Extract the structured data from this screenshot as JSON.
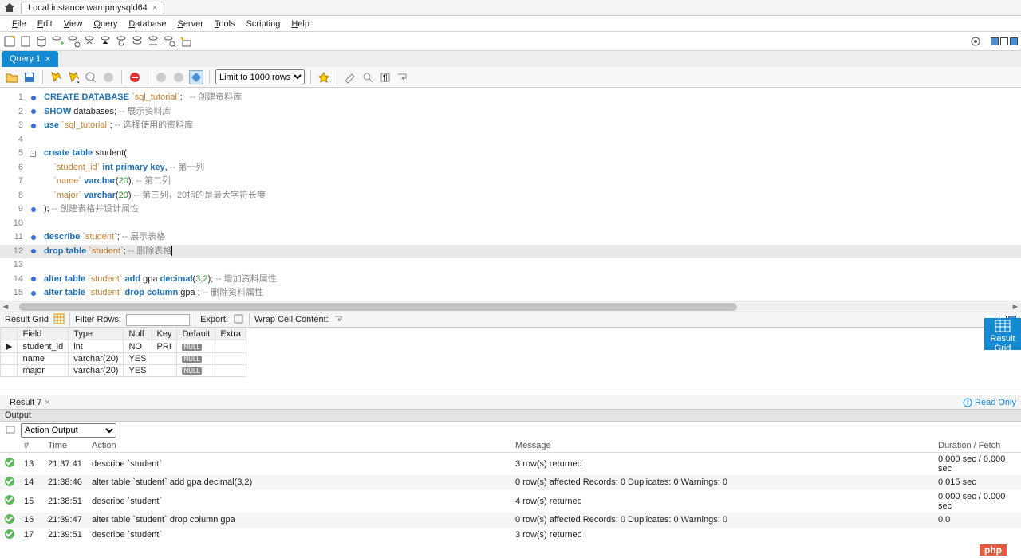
{
  "titlebar": {
    "tab_label": "Local instance wampmysqld64"
  },
  "menubar": [
    {
      "mn": "F",
      "rest": "ile"
    },
    {
      "mn": "E",
      "rest": "dit"
    },
    {
      "mn": "V",
      "rest": "iew"
    },
    {
      "mn": "Q",
      "rest": "uery"
    },
    {
      "mn": "D",
      "rest": "atabase"
    },
    {
      "mn": "S",
      "rest": "erver"
    },
    {
      "mn": "T",
      "rest": "ools"
    },
    {
      "mn": "",
      "rest": "Scripting"
    },
    {
      "mn": "H",
      "rest": "elp"
    }
  ],
  "query_tab": "Query 1",
  "limit_rows": "Limit to 1000 rows",
  "code": [
    {
      "n": 1,
      "dot": true,
      "html": "<span class='kw'>CREATE</span> <span class='kw'>DATABASE</span> <span class='str'>`sql_tutorial`</span>;   <span class='cm'>-- 创建资料库</span>"
    },
    {
      "n": 2,
      "dot": true,
      "html": "<span class='kw'>SHOW</span> databases; <span class='cm'>-- 展示资料库</span>"
    },
    {
      "n": 3,
      "dot": true,
      "html": "<span class='kw'>use</span> <span class='str'>`sql_tutorial`</span>; <span class='cm'>-- 选择使用的资料库</span>"
    },
    {
      "n": 4,
      "dot": false,
      "html": ""
    },
    {
      "n": 5,
      "dot": true,
      "fold": true,
      "html": "<span class='kw'>create</span> <span class='kw'>table</span> student("
    },
    {
      "n": 6,
      "dot": false,
      "html": "    <span class='str'>`student_id`</span> <span class='kw'>int</span> <span class='kw'>primary key</span>, <span class='cm'>-- 第一列</span>"
    },
    {
      "n": 7,
      "dot": false,
      "html": "    <span class='str'>`name`</span> <span class='kw'>varchar</span>(<span class='num'>20</span>), <span class='cm'>-- 第二列</span>"
    },
    {
      "n": 8,
      "dot": false,
      "html": "    <span class='str'>`major`</span> <span class='kw'>varchar</span>(<span class='num'>20</span>) <span class='cm'>-- 第三列，20指的是最大字符长度</span>"
    },
    {
      "n": 9,
      "dot": true,
      "html": "); <span class='cm'>-- 创建表格并设计属性</span>"
    },
    {
      "n": 10,
      "dot": false,
      "html": ""
    },
    {
      "n": 11,
      "dot": true,
      "html": "<span class='kw'>describe</span> <span class='str'>`student`</span>; <span class='cm'>-- 展示表格</span>"
    },
    {
      "n": 12,
      "dot": true,
      "hl": true,
      "html": "<span class='kw'>drop</span> <span class='kw'>table</span> <span class='str'>`student`</span>; <span class='cm'>-- 删除表格</span>",
      "cursor": true
    },
    {
      "n": 13,
      "dot": false,
      "html": ""
    },
    {
      "n": 14,
      "dot": true,
      "html": "<span class='kw'>alter</span> <span class='kw'>table</span> <span class='str'>`student`</span> <span class='kw'>add</span> gpa <span class='kw'>decimal</span>(<span class='num'>3</span>,<span class='num'>2</span>); <span class='cm'>-- 增加资料属性</span>"
    },
    {
      "n": 15,
      "dot": true,
      "html": "<span class='kw'>alter</span> <span class='kw'>table</span> <span class='str'>`student`</span> <span class='kw'>drop</span> <span class='kw'>column</span> gpa ; <span class='cm'>-- 删除资料属性</span>"
    }
  ],
  "result_toolbar": {
    "result_grid_label": "Result Grid",
    "filter_rows_label": "Filter Rows:",
    "export_label": "Export:",
    "wrap_label": "Wrap Cell Content:"
  },
  "result_right_btn": {
    "line1": "Result",
    "line2": "Grid"
  },
  "result_columns": [
    "Field",
    "Type",
    "Null",
    "Key",
    "Default",
    "Extra"
  ],
  "result_rows": [
    {
      "Field": "student_id",
      "Type": "int",
      "Null": "NO",
      "Key": "PRI",
      "Default": "NULL",
      "Extra": ""
    },
    {
      "Field": "name",
      "Type": "varchar(20)",
      "Null": "YES",
      "Key": "",
      "Default": "NULL",
      "Extra": ""
    },
    {
      "Field": "major",
      "Type": "varchar(20)",
      "Null": "YES",
      "Key": "",
      "Default": "NULL",
      "Extra": ""
    }
  ],
  "result_tab_label": "Result 7",
  "read_only_label": "Read Only",
  "output_header": "Output",
  "action_output_label": "Action Output",
  "output_columns": {
    "num": "#",
    "time": "Time",
    "action": "Action",
    "message": "Message",
    "duration": "Duration / Fetch"
  },
  "output_rows": [
    {
      "num": "13",
      "time": "21:37:41",
      "action": "describe `student`",
      "message": "3 row(s) returned",
      "duration": "0.000 sec / 0.000 sec"
    },
    {
      "num": "14",
      "time": "21:38:46",
      "action": "alter table `student` add gpa decimal(3,2)",
      "message": "0 row(s) affected Records: 0  Duplicates: 0  Warnings: 0",
      "duration": "0.015 sec"
    },
    {
      "num": "15",
      "time": "21:38:51",
      "action": "describe `student`",
      "message": "4 row(s) returned",
      "duration": "0.000 sec / 0.000 sec"
    },
    {
      "num": "16",
      "time": "21:39:47",
      "action": "alter table `student` drop column gpa",
      "message": "0 row(s) affected Records: 0  Duplicates: 0  Warnings: 0",
      "duration": "0.0"
    },
    {
      "num": "17",
      "time": "21:39:51",
      "action": "describe `student`",
      "message": "3 row(s) returned",
      "duration": ""
    }
  ],
  "footer_badge": "php"
}
